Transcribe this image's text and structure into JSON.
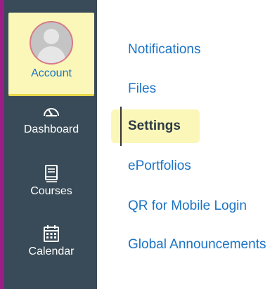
{
  "global_nav": {
    "accent_color": "#9b1e87",
    "background_color": "#394b58",
    "items": [
      {
        "label": "Account",
        "icon": "avatar-icon",
        "active": true
      },
      {
        "label": "Dashboard",
        "icon": "speedometer-icon"
      },
      {
        "label": "Courses",
        "icon": "book-icon"
      },
      {
        "label": "Calendar",
        "icon": "calendar-icon"
      }
    ]
  },
  "account_menu": {
    "link_color": "#1b73c4",
    "highlight_color": "#fbf7b8",
    "items": [
      {
        "label": "Notifications"
      },
      {
        "label": "Files"
      },
      {
        "label": "Settings",
        "active": true
      },
      {
        "label": "ePortfolios"
      },
      {
        "label": "QR for Mobile Login"
      },
      {
        "label": "Global Announcements"
      }
    ]
  }
}
